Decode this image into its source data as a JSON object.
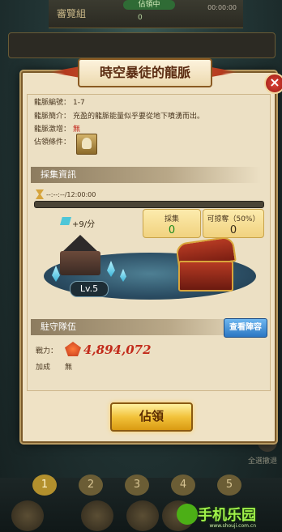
{
  "background": {
    "top_title": "審覽組",
    "top_status": "佔領中",
    "top_meta": "00:00:00",
    "top_sub": "0",
    "tabs": [
      "1",
      "2",
      "3",
      "4",
      "5"
    ],
    "active_tab_index": 0,
    "side_label": "全選撤退",
    "watermark": "手机乐园",
    "watermark_url": "www.shouji.com.cn"
  },
  "modal": {
    "title": "時空暴徒的龍脈",
    "close_icon": "×",
    "info": {
      "id_label": "龍脈編號：",
      "id_value": "1-7",
      "desc_label": "龍脈簡介：",
      "desc_value": "充盈的龍脈能量似乎要從地下噴湧而出。",
      "bonus_label": "龍脈激增：",
      "bonus_value": "無",
      "cond_label": "佔領條件："
    },
    "collect_section": "採集資訊",
    "timer": "--:--:--/12:00:00",
    "progress": 0,
    "rate": "+9/分",
    "stats": [
      {
        "label": "採集",
        "value": "0"
      },
      {
        "label": "可掠奪（50%）",
        "value": "0"
      }
    ],
    "level": "Lv.5",
    "garrison_section": "駐守隊伍",
    "defend_button": "查看陣容",
    "power_label": "戰力：",
    "power_value": "4,894,072",
    "bonus_label": "加成",
    "bonus_value": "無",
    "occupy_button": "佔領"
  },
  "colors": {
    "panel": "#efe2c5",
    "accent_red": "#c22a1a",
    "gold": "#f2c23a",
    "green_value": "#1d8a1d"
  }
}
